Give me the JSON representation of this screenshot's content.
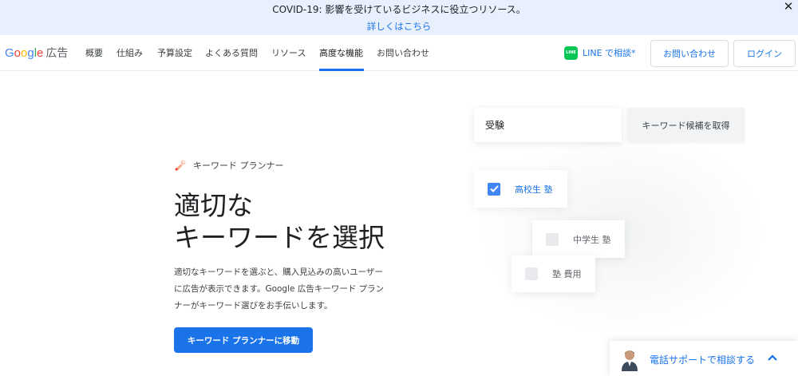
{
  "banner": {
    "text": "COVID-19: 影響を受けているビジネスに役立つリソース。",
    "link": "詳しくはこちら",
    "close_icon": "close-icon"
  },
  "nav": {
    "logo_google": [
      "G",
      "o",
      "o",
      "g",
      "l",
      "e"
    ],
    "logo_product": "広告",
    "items": [
      "概要",
      "仕組み",
      "予算設定",
      "よくある質問",
      "リソース",
      "高度な機能",
      "お問い合わせ"
    ],
    "active_item": "高度な機能",
    "line_icon_text": "LINE",
    "line_label": "LINE で相談*",
    "contact_button": "お問い合わせ",
    "login_button": "ログイン"
  },
  "hero": {
    "badge_icon": "wrench-icon",
    "badge_label": "キーワード プランナー",
    "title_line1": "適切な",
    "title_line2": "キーワードを選択",
    "description": "適切なキーワードを選ぶと、購入見込みの高いユーザーに広告が表示できます。Google 広告キーワード プランナーがキーワード選びをお手伝いします。",
    "cta": "キーワード プランナーに移動"
  },
  "illustration": {
    "input_value": "受験",
    "get_button": "キーワード候補を取得",
    "chips": [
      {
        "label": "高校生 塾",
        "checked": true
      },
      {
        "label": "中学生 塾",
        "checked": false
      },
      {
        "label": "塾 費用",
        "checked": false
      }
    ]
  },
  "support": {
    "label": "電話サポートで相談する",
    "chevron_icon": "chevron-up-icon"
  },
  "colors": {
    "accent": "#1a73e8",
    "banner_bg": "#e8f0fe",
    "line_green": "#06c755"
  }
}
